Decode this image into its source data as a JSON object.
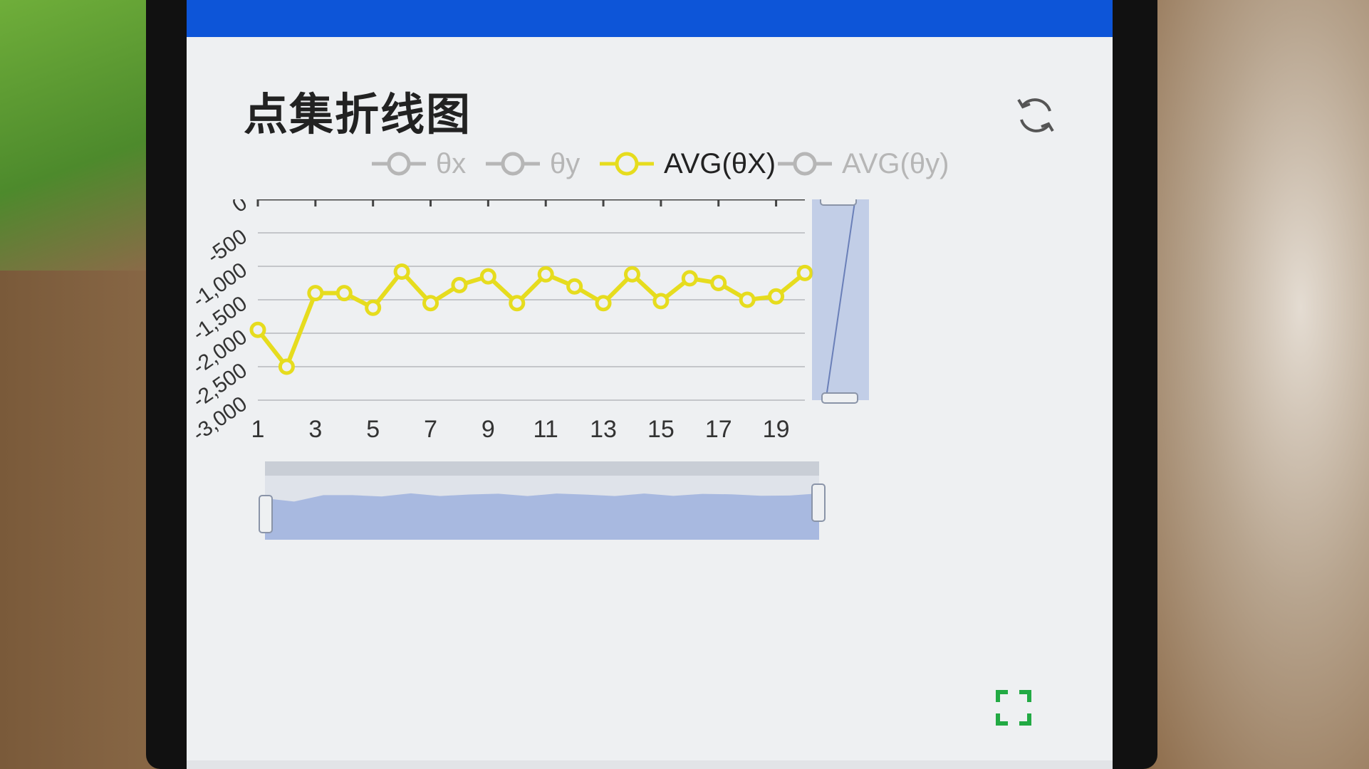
{
  "title": "点集折线图",
  "icons": {
    "refresh": "refresh-icon",
    "fullscreen": "fullscreen-icon"
  },
  "colors": {
    "header": "#0d55d8",
    "active_series": "#e6dc1e",
    "inactive_series": "#b6b6b6",
    "zoom_fill": "#9fb2de",
    "fullscreen_icon": "#22aa44"
  },
  "legend": [
    {
      "label": "θx",
      "active": false
    },
    {
      "label": "θy",
      "active": false
    },
    {
      "label": "AVG(θX)",
      "active": true
    },
    {
      "label": "AVG(θy)",
      "active": false
    }
  ],
  "chart_data": {
    "type": "line",
    "x": [
      1,
      2,
      3,
      4,
      5,
      6,
      7,
      8,
      9,
      10,
      11,
      12,
      13,
      14,
      15,
      16,
      17,
      18,
      19,
      20
    ],
    "x_tick_labels": [
      "1",
      "3",
      "5",
      "7",
      "9",
      "11",
      "13",
      "15",
      "17",
      "19"
    ],
    "y_tick_labels": [
      "0",
      "-500",
      "-1,000",
      "-1,500",
      "-2,000",
      "-2,500",
      "-3,000"
    ],
    "ylim": [
      -3000,
      0
    ],
    "grid": true,
    "legend_position": "top",
    "series": [
      {
        "name": "AVG(θX)",
        "values": [
          -1950,
          -2500,
          -1400,
          -1400,
          -1620,
          -1080,
          -1550,
          -1280,
          -1150,
          -1550,
          -1120,
          -1300,
          -1550,
          -1120,
          -1520,
          -1180,
          -1250,
          -1500,
          -1450,
          -1100
        ]
      }
    ]
  }
}
